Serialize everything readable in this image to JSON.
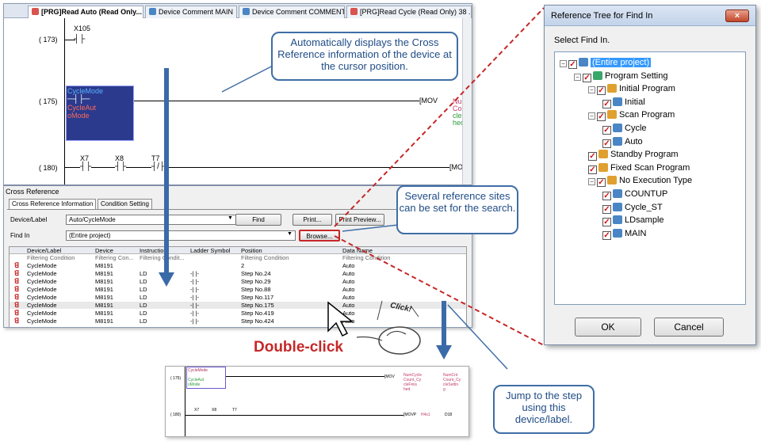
{
  "tabs": [
    {
      "label": "[PRG]Read Auto (Read Only...",
      "close": "×",
      "active": true
    },
    {
      "label": "Device Comment MAIN",
      "active": false
    },
    {
      "label": "Device Comment COMMENT",
      "active": false
    },
    {
      "label": "[PRG]Read Cycle (Read Only) 38 ...",
      "active": false
    }
  ],
  "ladder": {
    "rungs": [
      {
        "step": "( 173)",
        "contact": "X105"
      },
      {
        "step": "( 175)",
        "contact": "CycleMode",
        "cursor_text": "CycleAut\noMode",
        "instruction": "[MOV",
        "operand_lines": [
          "NumC",
          "Coun",
          "cleFi",
          "hed"
        ]
      },
      {
        "step": "( 180)",
        "contacts": [
          "X7",
          "X8",
          "T7"
        ],
        "instruction": "[MOV"
      }
    ]
  },
  "cross_reference": {
    "title": "Cross Reference",
    "subtabs": [
      "Cross Reference Information",
      "Condition Setting"
    ],
    "device_label_caption": "Device/Label",
    "device_label_value": "Auto/CycleMode",
    "find_in_caption": "Find In",
    "find_in_value": "(Entire project)",
    "buttons": {
      "find": "Find",
      "print": "Print...",
      "print_preview": "Print Preview...",
      "browse": "Browse..."
    },
    "columns": [
      "Device/Label",
      "Device",
      "Instruction",
      "Ladder Symbol",
      "Position",
      "Data Name"
    ],
    "filter_row": [
      "Filtering Condition",
      "Filtering Con...",
      "Filtering Condit...",
      "",
      "Filtering Condition",
      "Filtering Condition"
    ],
    "rows": [
      [
        "CycleMode",
        "M8191",
        "",
        "",
        "2",
        "Auto"
      ],
      [
        "CycleMode",
        "M8191",
        "LD",
        "-| |-",
        "Step No.24",
        "Auto"
      ],
      [
        "CycleMode",
        "M8191",
        "LD",
        "-| |-",
        "Step No.29",
        "Auto"
      ],
      [
        "CycleMode",
        "M8191",
        "LD",
        "-| |-",
        "Step No.88",
        "Auto"
      ],
      [
        "CycleMode",
        "M8191",
        "LD",
        "-| |-",
        "Step No.117",
        "Auto"
      ],
      [
        "CycleMode",
        "M8191",
        "LD",
        "-| |-",
        "Step No.175",
        "Auto"
      ],
      [
        "CycleMode",
        "M8191",
        "LD",
        "-| |-",
        "Step No.419",
        "Auto"
      ],
      [
        "CycleMode",
        "M8191",
        "LD",
        "-| |-",
        "Step No.424",
        "Auto"
      ]
    ]
  },
  "callouts": {
    "top": "Automatically displays the Cross Reference information of the device at the cursor position.",
    "middle": "Several reference sites can be set for the search.",
    "bottom": "Jump to the step using this device/label.",
    "double_click": "Double-click",
    "click": "Click!"
  },
  "dialog": {
    "title": "Reference Tree for Find In",
    "close": "×",
    "caption": "Select Find In.",
    "tree": [
      {
        "label": "(Entire project)",
        "level": 0,
        "selected": true
      },
      {
        "label": "Program Setting",
        "level": 1
      },
      {
        "label": "Initial Program",
        "level": 2
      },
      {
        "label": "Initial",
        "level": 3
      },
      {
        "label": "Scan Program",
        "level": 2
      },
      {
        "label": "Cycle",
        "level": 3
      },
      {
        "label": "Auto",
        "level": 3
      },
      {
        "label": "Standby Program",
        "level": 2
      },
      {
        "label": "Fixed Scan Program",
        "level": 2
      },
      {
        "label": "No Execution Type",
        "level": 2
      },
      {
        "label": "COUNTUP",
        "level": 3
      },
      {
        "label": "Cycle_ST",
        "level": 3
      },
      {
        "label": "LDsample",
        "level": 3
      },
      {
        "label": "MAIN",
        "level": 3
      }
    ],
    "ok": "OK",
    "cancel": "Cancel"
  },
  "mini_ladder": {
    "step1": "( 175)",
    "contact1": "CycleMode",
    "contact1b": "CycleAut\noMode",
    "instr1": "[MOV",
    "op1": "NumCycle\nCount_Cy\ncleFinis\nhed",
    "op1b": "NumCnt\nCount_Cy\ncleSettin\ng",
    "step2": "( 180)",
    "c2a": "X7",
    "c2b": "X8",
    "c2c": "T7",
    "instr2": "[MOVP",
    "op2": "H4s1",
    "op2b": "D18"
  },
  "colors": {
    "accent": "#3f6ea6",
    "red_dashed": "#c62828",
    "double_click": "#c62828"
  }
}
